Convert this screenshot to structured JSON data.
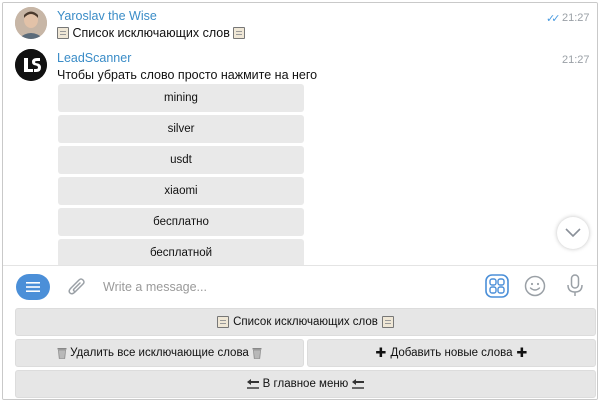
{
  "messages": [
    {
      "sender": "Yaroslav the Wise",
      "text": "Список исключающих слов",
      "time": "21:27",
      "read_ticks": "✓✓"
    },
    {
      "sender": "LeadScanner",
      "text": "Чтобы убрать слово просто нажмите на него",
      "time": "21:27"
    }
  ],
  "inline_keyboard": [
    "mining",
    "silver",
    "usdt",
    "xiaomi",
    "бесплатно",
    "бесплатной"
  ],
  "input": {
    "placeholder": "Write a message..."
  },
  "reply_keyboard": {
    "list_words": "Список исключающих слов",
    "delete_all": "Удалить все исключающие слова",
    "add_new": "Добавить новые слова",
    "main_menu": "В главное меню"
  },
  "colors": {
    "accent": "#4b8fd8",
    "sender_name": "#3a8cc7",
    "button_bg": "#e6e6e6"
  }
}
